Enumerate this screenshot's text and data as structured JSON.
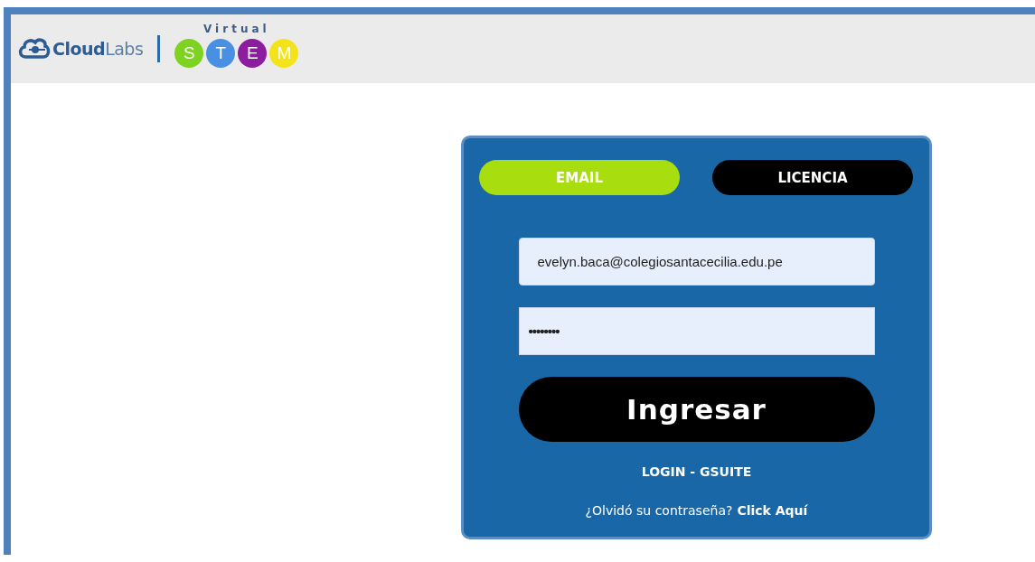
{
  "header": {
    "logo": {
      "brand_bold": "Cloud",
      "brand_light": "Labs",
      "tagline": "Virtual",
      "letters": [
        {
          "text": "S",
          "color": "#7ed321"
        },
        {
          "text": "T",
          "color": "#4a90e2"
        },
        {
          "text": "E",
          "color": "#8b1d9e"
        },
        {
          "text": "M",
          "color": "#f5e31a"
        }
      ]
    }
  },
  "login": {
    "tabs": [
      {
        "label": "EMAIL",
        "selected": true
      },
      {
        "label": "LICENCIA",
        "selected": false
      }
    ],
    "email_field": {
      "value": "evelyn.baca@colegiosantacecilia.edu.pe"
    },
    "password_field": {
      "value": "••••••••"
    },
    "submit_button": "Ingresar",
    "gsuite_link": "LOGIN - GSUITE",
    "forgot": {
      "text": "¿Olvidó su contraseña?",
      "link": "Click Aquí"
    }
  }
}
